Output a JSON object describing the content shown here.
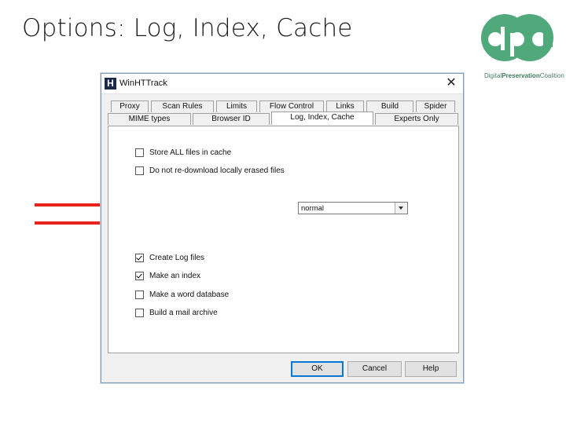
{
  "slide": {
    "title": "Options: Log, Index, Cache"
  },
  "logo": {
    "mark": "dpc",
    "text_prefix": "Digital",
    "text_bold": "Preservation",
    "text_suffix": "Coalition",
    "color": "#4fa97a"
  },
  "arrows": {
    "color": "#e8231c"
  },
  "dialog": {
    "title": "WinHTTrack",
    "app_icon_letter": "H",
    "tabs_row1": [
      "Proxy",
      "Scan Rules",
      "Limits",
      "Flow Control",
      "Links",
      "Build",
      "Spider"
    ],
    "tabs_row2": [
      "MIME types",
      "Browser ID",
      "Log, Index, Cache",
      "Experts Only"
    ],
    "active_tab": "Log, Index, Cache",
    "options": [
      {
        "label": "Store ALL files in cache",
        "checked": false
      },
      {
        "label": "Do not re-download locally erased files",
        "checked": false
      },
      {
        "label": "Create Log files",
        "checked": true
      },
      {
        "label": "Make an index",
        "checked": true
      },
      {
        "label": "Make a word database",
        "checked": false
      },
      {
        "label": "Build a mail archive",
        "checked": false
      }
    ],
    "log_level_select": {
      "value": "normal"
    },
    "buttons": {
      "ok": "OK",
      "cancel": "Cancel",
      "help": "Help"
    }
  }
}
